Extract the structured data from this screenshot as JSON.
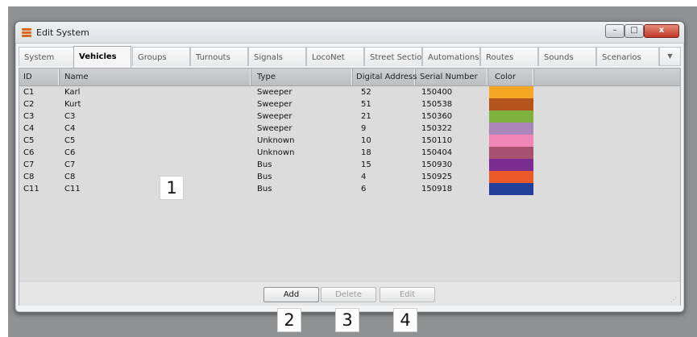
{
  "window": {
    "title": "Edit System",
    "minimize_glyph": "–",
    "maximize_glyph": "□",
    "close_glyph": "x",
    "app_icon": "app-icon"
  },
  "tabs": [
    {
      "label": "System",
      "active": false
    },
    {
      "label": "Vehicles",
      "active": true
    },
    {
      "label": "Groups",
      "active": false
    },
    {
      "label": "Turnouts",
      "active": false
    },
    {
      "label": "Signals",
      "active": false
    },
    {
      "label": "LocoNet",
      "active": false
    },
    {
      "label": "Street Sectio...",
      "active": false
    },
    {
      "label": "Automations",
      "active": false
    },
    {
      "label": "Routes",
      "active": false
    },
    {
      "label": "Sounds",
      "active": false
    },
    {
      "label": "Scenarios",
      "active": false
    }
  ],
  "tab_scroll_glyph": "▼",
  "table": {
    "columns": [
      "ID",
      "Name",
      "Type",
      "Digital Address",
      "Serial Number",
      "Color"
    ],
    "rows": [
      {
        "id": "C1",
        "name": "Karl",
        "type": "Sweeper",
        "address": "52",
        "serial": "150400",
        "color": "#f5a623"
      },
      {
        "id": "C2",
        "name": "Kurt",
        "type": "Sweeper",
        "address": "51",
        "serial": "150538",
        "color": "#b5531c"
      },
      {
        "id": "C3",
        "name": "C3",
        "type": "Sweeper",
        "address": "21",
        "serial": "150360",
        "color": "#7fb13e"
      },
      {
        "id": "C4",
        "name": "C4",
        "type": "Sweeper",
        "address": "9",
        "serial": "150322",
        "color": "#a985ba"
      },
      {
        "id": "C5",
        "name": "C5",
        "type": "Unknown",
        "address": "10",
        "serial": "150110",
        "color": "#ef86b6"
      },
      {
        "id": "C6",
        "name": "C6",
        "type": "Unknown",
        "address": "18",
        "serial": "150404",
        "color": "#a8506f"
      },
      {
        "id": "C7",
        "name": "C7",
        "type": "Bus",
        "address": "15",
        "serial": "150930",
        "color": "#7a2c91"
      },
      {
        "id": "C8",
        "name": "C8",
        "type": "Bus",
        "address": "4",
        "serial": "150925",
        "color": "#ec5a2a"
      },
      {
        "id": "C11",
        "name": "C11",
        "type": "Bus",
        "address": "6",
        "serial": "150918",
        "color": "#22409b"
      }
    ]
  },
  "buttons": {
    "add": "Add",
    "delete": "Delete",
    "edit": "Edit"
  },
  "callouts": [
    "1",
    "2",
    "3",
    "4"
  ]
}
